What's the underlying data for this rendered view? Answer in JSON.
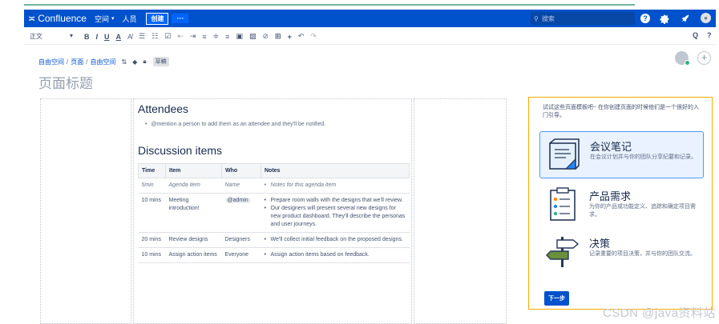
{
  "nav": {
    "logo": "Confluence",
    "spaces": "空间",
    "people": "人员",
    "create": "创建",
    "more": "···",
    "search_placeholder": "搜索",
    "help": "?"
  },
  "toolbar": {
    "style": "正文",
    "bold": "B",
    "italic": "I",
    "underline": "U",
    "color": "A",
    "format": "A̸",
    "bullet": "☰",
    "numbered": "☷",
    "task": "☑",
    "outdent": "⇤",
    "indent": "⇥",
    "align_left": "≡",
    "align_center": "≑",
    "align_right": "≡",
    "layout": "▣",
    "image": "▨",
    "link": "⊘",
    "table": "⊞",
    "insert": "+",
    "undo": "↶",
    "redo": "↷",
    "search": "Q",
    "help": "?"
  },
  "breadcrumb": [
    "自由空间",
    "页面",
    "自由空间"
  ],
  "draft_badge": "草稿",
  "page_title_placeholder": "页面标题",
  "template_preview": {
    "attendees_heading": "Attendees",
    "attendees_note": "@mention a person to add them as an attendee and they'll be notified.",
    "discussion_heading": "Discussion items",
    "columns": [
      "Time",
      "Item",
      "Who",
      "Notes"
    ],
    "rows": [
      {
        "time": "5min",
        "item": "Agenda item",
        "who": "Name",
        "notes": [
          "Notes for this agenda item"
        ],
        "italic": true
      },
      {
        "time": "10 mins",
        "item": "Meeting introduction!",
        "who": "@admin",
        "notes": [
          "Prepare room walls with the designs that we'll review.",
          "Our designers will present several new designs for new product dashboard. They'll describe the personas and user journeys."
        ],
        "italic": false
      },
      {
        "time": "20 mins",
        "item": "Review designs",
        "who": "Designers",
        "notes": [
          "We'll collect initial feedback on the proposed designs."
        ],
        "italic": false
      },
      {
        "time": "10 mins",
        "item": "Assign action items",
        "who": "Everyone",
        "notes": [
          "Assign action items based on feedback."
        ],
        "italic": false
      }
    ]
  },
  "chooser": {
    "intro": "试试这些页面模板吧~ 在你创建页面的时候他们是一个很好的入门引导。",
    "templates": [
      {
        "title": "会议笔记",
        "desc": "在会议计划并与你的团队分享纪要和记录。",
        "icon": "meeting-notes-icon"
      },
      {
        "title": "产品需求",
        "desc": "为你的产品或功能定义、追踪和确定项目需求。",
        "icon": "product-requirements-icon"
      },
      {
        "title": "决策",
        "desc": "记录重要的项目决策，并与你的团队交流。",
        "icon": "decision-signpost-icon"
      }
    ],
    "next": "下一步"
  },
  "watermark": "CSDN @java资料站",
  "colors": {
    "nav_bg": "#0052cc",
    "accent": "#0065ff",
    "chooser_border": "#ffab00",
    "selected_bg": "#eaf2ff"
  }
}
